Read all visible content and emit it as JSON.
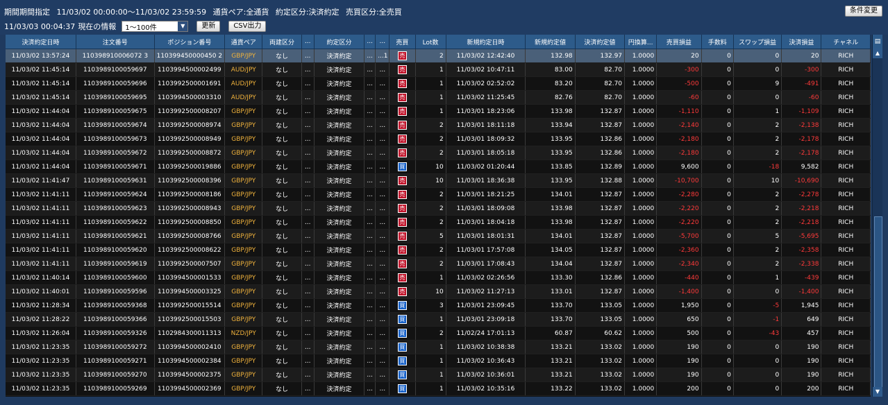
{
  "header": {
    "period_label": "期間期間指定",
    "period_value": "11/03/02 00:00:00〜11/03/02 23:59:59",
    "pair_filter": "通貨ペア:全通貨",
    "contract_filter": "約定区分:決済約定",
    "side_filter": "売買区分:全売買",
    "condition_button": "条件変更",
    "info_time": "11/03/03 00:04:37",
    "info_label": "現在の情報",
    "range_select": "1〜100件",
    "refresh_button": "更新",
    "csv_button": "CSV出力"
  },
  "columns": [
    "決済約定日時",
    "注文番号",
    "ポジション番号",
    "通貨ペア",
    "両建区分",
    "...",
    "約定区分",
    "...",
    "...",
    "売買",
    "Lot数",
    "新規約定日時",
    "新規約定値",
    "決済約定値",
    "円換算...",
    "売買損益",
    "手数料",
    "スワップ損益",
    "決済損益",
    "チャネル"
  ],
  "side_labels": {
    "sell": "売",
    "buy": "買"
  },
  "rows": [
    [
      "11/03/02 13:57:24",
      "110398910006072 3",
      "110399450000450 2",
      "GBP/JPY",
      "なし",
      "...",
      "決済約定",
      "...",
      "...1",
      "sell",
      "2",
      "11/03/02 12:42:40",
      "132.98",
      "132.97",
      "1.0000",
      "20",
      "0",
      "0",
      "20",
      "RICH"
    ],
    [
      "11/03/02 11:45:14",
      "1103989100059697",
      "1103994500002499",
      "AUD/JPY",
      "なし",
      "...",
      "決済約定",
      "...",
      "...",
      "sell",
      "1",
      "11/03/02 10:47:11",
      "83.00",
      "82.70",
      "1.0000",
      "-300",
      "0",
      "0",
      "-300",
      "RICH"
    ],
    [
      "11/03/02 11:45:14",
      "1103989100059696",
      "1103992500001691",
      "AUD/JPY",
      "なし",
      "...",
      "決済約定",
      "...",
      "...",
      "sell",
      "1",
      "11/03/02 02:52:02",
      "83.20",
      "82.70",
      "1.0000",
      "-500",
      "0",
      "9",
      "-491",
      "RICH"
    ],
    [
      "11/03/02 11:45:14",
      "1103989100059695",
      "1103994500003310",
      "AUD/JPY",
      "なし",
      "...",
      "決済約定",
      "...",
      "...",
      "sell",
      "1",
      "11/03/02 11:25:45",
      "82.76",
      "82.70",
      "1.0000",
      "-60",
      "0",
      "0",
      "-60",
      "RICH"
    ],
    [
      "11/03/02 11:44:04",
      "1103989100059675",
      "1103992500008207",
      "GBP/JPY",
      "なし",
      "...",
      "決済約定",
      "...",
      "...",
      "sell",
      "1",
      "11/03/01 18:23:06",
      "133.98",
      "132.87",
      "1.0000",
      "-1,110",
      "0",
      "1",
      "-1,109",
      "RICH"
    ],
    [
      "11/03/02 11:44:04",
      "1103989100059674",
      "1103992500008974",
      "GBP/JPY",
      "なし",
      "...",
      "決済約定",
      "...",
      "...",
      "sell",
      "2",
      "11/03/01 18:11:18",
      "133.94",
      "132.87",
      "1.0000",
      "-2,140",
      "0",
      "2",
      "-2,138",
      "RICH"
    ],
    [
      "11/03/02 11:44:04",
      "1103989100059673",
      "1103992500008949",
      "GBP/JPY",
      "なし",
      "...",
      "決済約定",
      "...",
      "...",
      "sell",
      "2",
      "11/03/01 18:09:32",
      "133.95",
      "132.86",
      "1.0000",
      "-2,180",
      "0",
      "2",
      "-2,178",
      "RICH"
    ],
    [
      "11/03/02 11:44:04",
      "1103989100059672",
      "1103992500008872",
      "GBP/JPY",
      "なし",
      "...",
      "決済約定",
      "...",
      "...",
      "sell",
      "2",
      "11/03/01 18:05:18",
      "133.95",
      "132.86",
      "1.0000",
      "-2,180",
      "0",
      "2",
      "-2,178",
      "RICH"
    ],
    [
      "11/03/02 11:44:04",
      "1103989100059671",
      "1103992500019886",
      "GBP/JPY",
      "なし",
      "...",
      "決済約定",
      "...",
      "...",
      "buy",
      "10",
      "11/03/02 01:20:44",
      "133.85",
      "132.89",
      "1.0000",
      "9,600",
      "0",
      "-18",
      "9,582",
      "RICH"
    ],
    [
      "11/03/02 11:41:47",
      "1103989100059631",
      "1103992500008396",
      "GBP/JPY",
      "なし",
      "...",
      "決済約定",
      "...",
      "...",
      "sell",
      "10",
      "11/03/01 18:36:38",
      "133.95",
      "132.88",
      "1.0000",
      "-10,700",
      "0",
      "10",
      "-10,690",
      "RICH"
    ],
    [
      "11/03/02 11:41:11",
      "1103989100059624",
      "1103992500008186",
      "GBP/JPY",
      "なし",
      "...",
      "決済約定",
      "...",
      "...",
      "sell",
      "2",
      "11/03/01 18:21:25",
      "134.01",
      "132.87",
      "1.0000",
      "-2,280",
      "0",
      "2",
      "-2,278",
      "RICH"
    ],
    [
      "11/03/02 11:41:11",
      "1103989100059623",
      "1103992500008943",
      "GBP/JPY",
      "なし",
      "...",
      "決済約定",
      "...",
      "...",
      "sell",
      "2",
      "11/03/01 18:09:08",
      "133.98",
      "132.87",
      "1.0000",
      "-2,220",
      "0",
      "2",
      "-2,218",
      "RICH"
    ],
    [
      "11/03/02 11:41:11",
      "1103989100059622",
      "1103992500008850",
      "GBP/JPY",
      "なし",
      "...",
      "決済約定",
      "...",
      "...",
      "sell",
      "2",
      "11/03/01 18:04:18",
      "133.98",
      "132.87",
      "1.0000",
      "-2,220",
      "0",
      "2",
      "-2,218",
      "RICH"
    ],
    [
      "11/03/02 11:41:11",
      "1103989100059621",
      "1103992500008766",
      "GBP/JPY",
      "なし",
      "...",
      "決済約定",
      "...",
      "...",
      "sell",
      "5",
      "11/03/01 18:01:31",
      "134.01",
      "132.87",
      "1.0000",
      "-5,700",
      "0",
      "5",
      "-5,695",
      "RICH"
    ],
    [
      "11/03/02 11:41:11",
      "1103989100059620",
      "1103992500008622",
      "GBP/JPY",
      "なし",
      "...",
      "決済約定",
      "...",
      "...",
      "sell",
      "2",
      "11/03/01 17:57:08",
      "134.05",
      "132.87",
      "1.0000",
      "-2,360",
      "0",
      "2",
      "-2,358",
      "RICH"
    ],
    [
      "11/03/02 11:41:11",
      "1103989100059619",
      "1103992500007507",
      "GBP/JPY",
      "なし",
      "...",
      "決済約定",
      "...",
      "...",
      "sell",
      "2",
      "11/03/01 17:08:43",
      "134.04",
      "132.87",
      "1.0000",
      "-2,340",
      "0",
      "2",
      "-2,338",
      "RICH"
    ],
    [
      "11/03/02 11:40:14",
      "1103989100059600",
      "1103994500001533",
      "GBP/JPY",
      "なし",
      "...",
      "決済約定",
      "...",
      "...",
      "sell",
      "1",
      "11/03/02 02:26:56",
      "133.30",
      "132.86",
      "1.0000",
      "-440",
      "0",
      "1",
      "-439",
      "RICH"
    ],
    [
      "11/03/02 11:40:01",
      "1103989100059596",
      "1103994500003325",
      "GBP/JPY",
      "なし",
      "...",
      "決済約定",
      "...",
      "...",
      "sell",
      "10",
      "11/03/02 11:27:13",
      "133.01",
      "132.87",
      "1.0000",
      "-1,400",
      "0",
      "0",
      "-1,400",
      "RICH"
    ],
    [
      "11/03/02 11:28:34",
      "1103989100059368",
      "1103992500015514",
      "GBP/JPY",
      "なし",
      "...",
      "決済約定",
      "...",
      "...",
      "buy",
      "3",
      "11/03/01 23:09:45",
      "133.70",
      "133.05",
      "1.0000",
      "1,950",
      "0",
      "-5",
      "1,945",
      "RICH"
    ],
    [
      "11/03/02 11:28:22",
      "1103989100059366",
      "1103992500015503",
      "GBP/JPY",
      "なし",
      "...",
      "決済約定",
      "...",
      "...",
      "buy",
      "1",
      "11/03/01 23:09:18",
      "133.70",
      "133.05",
      "1.0000",
      "650",
      "0",
      "-1",
      "649",
      "RICH"
    ],
    [
      "11/03/02 11:26:04",
      "1103989100059326",
      "1102984300011313",
      "NZD/JPY",
      "なし",
      "...",
      "決済約定",
      "...",
      "...",
      "buy",
      "2",
      "11/02/24 17:01:13",
      "60.87",
      "60.62",
      "1.0000",
      "500",
      "0",
      "-43",
      "457",
      "RICH"
    ],
    [
      "11/03/02 11:23:35",
      "1103989100059272",
      "1103994500002410",
      "GBP/JPY",
      "なし",
      "...",
      "決済約定",
      "...",
      "...",
      "buy",
      "1",
      "11/03/02 10:38:38",
      "133.21",
      "133.02",
      "1.0000",
      "190",
      "0",
      "0",
      "190",
      "RICH"
    ],
    [
      "11/03/02 11:23:35",
      "1103989100059271",
      "1103994500002384",
      "GBP/JPY",
      "なし",
      "...",
      "決済約定",
      "...",
      "...",
      "buy",
      "1",
      "11/03/02 10:36:43",
      "133.21",
      "133.02",
      "1.0000",
      "190",
      "0",
      "0",
      "190",
      "RICH"
    ],
    [
      "11/03/02 11:23:35",
      "1103989100059270",
      "1103994500002375",
      "GBP/JPY",
      "なし",
      "...",
      "決済約定",
      "...",
      "...",
      "buy",
      "1",
      "11/03/02 10:36:01",
      "133.21",
      "133.02",
      "1.0000",
      "190",
      "0",
      "0",
      "190",
      "RICH"
    ],
    [
      "11/03/02 11:23:35",
      "1103989100059269",
      "1103994500002369",
      "GBP/JPY",
      "なし",
      "...",
      "決済約定",
      "...",
      "...",
      "buy",
      "1",
      "11/03/02 10:35:16",
      "133.22",
      "133.02",
      "1.0000",
      "200",
      "0",
      "0",
      "200",
      "RICH"
    ]
  ],
  "colors": {
    "background": "#1f3a5f",
    "header": "#2d5b8a",
    "pair": "#f0b23c",
    "negative": "#ff3a3a",
    "sell": "#c0132a",
    "buy": "#1560c8"
  },
  "icons": {
    "scroll_up": "scroll-up-arrow-icon",
    "scroll_down": "scroll-down-arrow-icon",
    "column_chooser": "column-chooser-icon"
  }
}
